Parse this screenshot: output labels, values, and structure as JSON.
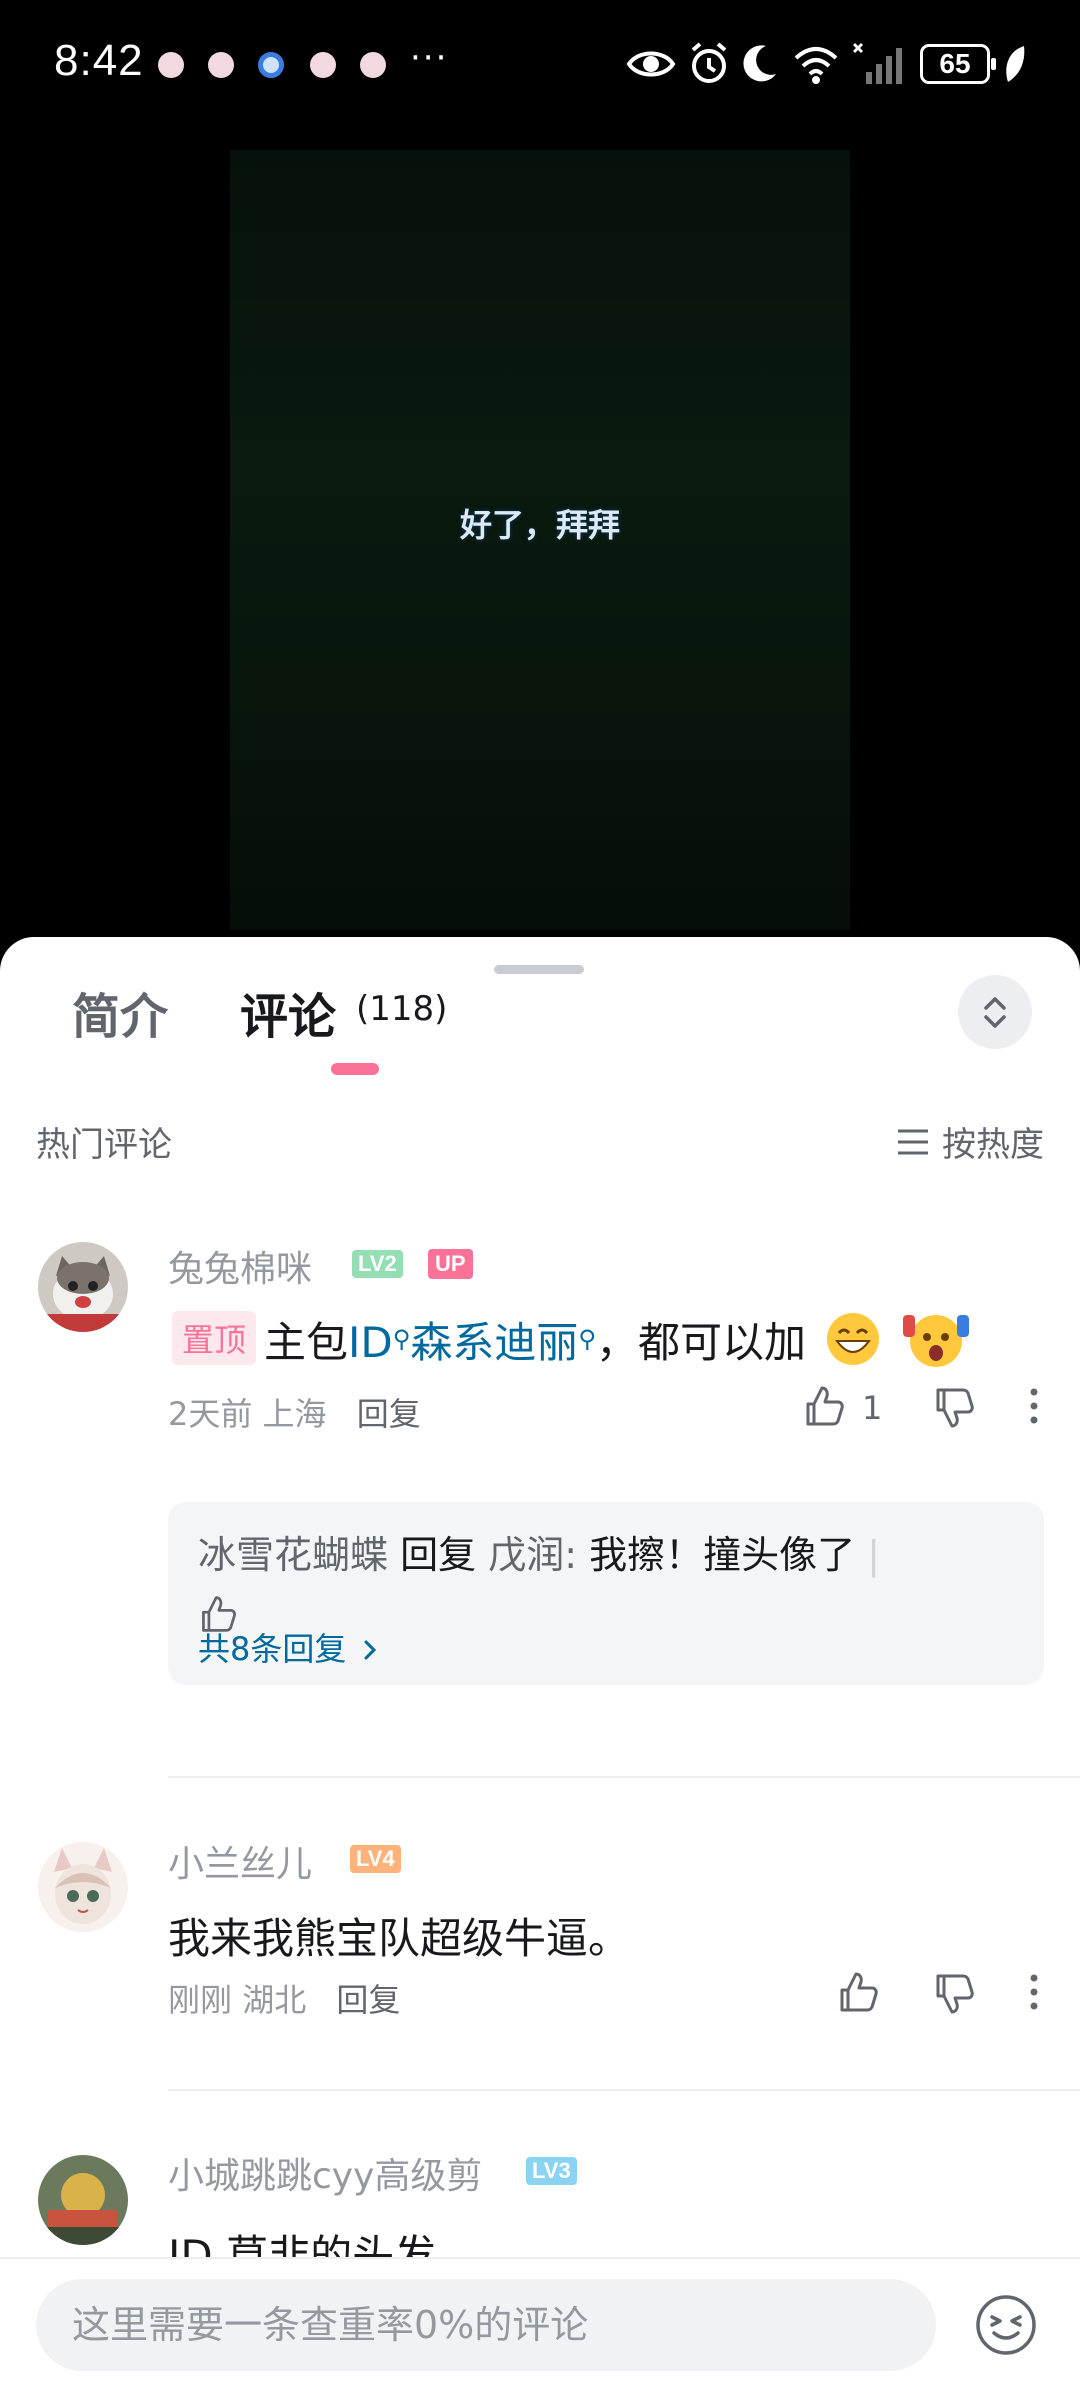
{
  "status_bar": {
    "time": "8:42",
    "more": "···",
    "battery": "65"
  },
  "video": {
    "subtitle": "好了，拜拜"
  },
  "tabs": {
    "intro": "简介",
    "comments": "评论",
    "comment_count": "(118)"
  },
  "section": {
    "hot_label": "热门评论",
    "sort_label": "按热度"
  },
  "comments": [
    {
      "username": "兔兔棉咪",
      "level": "LV2",
      "up_badge": "UP",
      "pin_label": "置顶",
      "text_a": "主包",
      "link_a": "ID",
      "link_b": "森系迪丽",
      "text_b": "，都可以加",
      "time": "2天前",
      "location": "上海",
      "reply": "回复",
      "likes": "1",
      "sub_reply": {
        "author": "冰雪花蝴蝶",
        "verb": "回复",
        "target": "戊润:",
        "text": "我擦！撞头像了",
        "more": "共8条回复"
      }
    },
    {
      "username": "小兰丝儿",
      "level": "LV4",
      "text": "我来我熊宝队超级牛逼。",
      "time": "刚刚",
      "location": "湖北",
      "reply": "回复"
    },
    {
      "username": "小城跳跳cyy高级剪",
      "level": "LV3",
      "text": "ID 草非的头发"
    }
  ],
  "input": {
    "placeholder": "这里需要一条查重率0%的评论"
  },
  "colors": {
    "accent": "#fb7299",
    "link": "#00699d",
    "lv2": "#95ddb2",
    "lv4": "#ffb37c",
    "lv3": "#8bd3f3"
  }
}
